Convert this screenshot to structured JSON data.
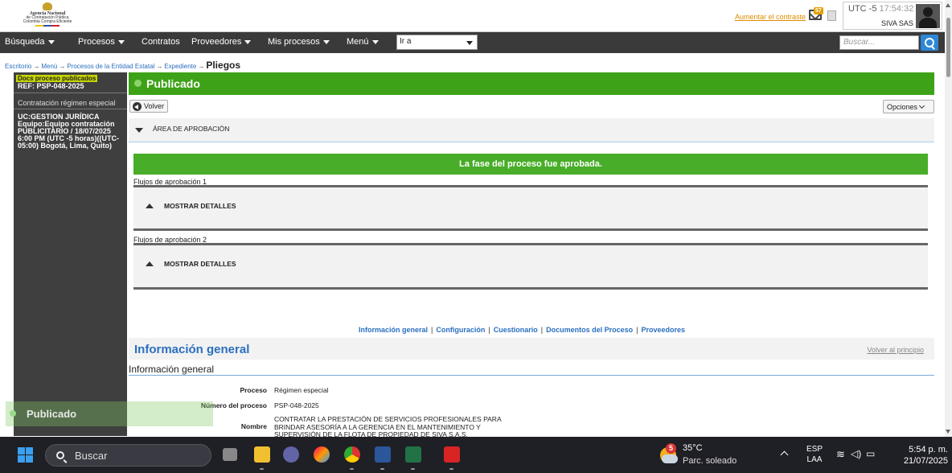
{
  "header": {
    "logo_line1": "Agencia Nacional",
    "logo_line2": "de Contratación Pública",
    "logo_line3": "Colombia Compra Eficiente",
    "contrast_link": "Aumentar el contraste",
    "mail_count": "57",
    "utc_label": "UTC -5",
    "utc_time": "17:54:32",
    "company": "SIVA SAS"
  },
  "nav": {
    "items": [
      "Búsqueda",
      "Procesos",
      "Contratos",
      "Proveedores",
      "Mis procesos",
      "Menú"
    ],
    "goto_value": "Ir a",
    "search_placeholder": "Buscar..."
  },
  "breadcrumb": {
    "items": [
      "Escritorio",
      "Menú",
      "Procesos de la Entidad Estatal",
      "Expediente"
    ],
    "current": "Pliegos"
  },
  "sidebar": {
    "selected_label": "Docs proceso publicados",
    "ref": "REF: PSP-048-2025",
    "item": "Contratación régimen especial",
    "info": "UC:GESTION JURÍDICA Equipo:Equipo contratación PUBLICITARIO / 18/07/2025 6:00 PM (UTC -5 horas)((UTC-05:00) Bogotá, Lima, Quito)"
  },
  "main": {
    "banner_title": "Publicado",
    "back_button": "Volver",
    "options_button": "Opciones",
    "approval_area": "ÁREA DE APROBACIÓN",
    "approved_message": "La fase del proceso fue aprobada.",
    "flows": [
      {
        "label": "Flujos de aprobación 1",
        "details": "MOSTRAR DETALLES"
      },
      {
        "label": "Flujos de aprobación 2",
        "details": "MOSTRAR DETALLES"
      }
    ],
    "section_links": [
      "Información general",
      "Configuración",
      "Cuestionario",
      "Documentos del Proceso",
      "Proveedores"
    ],
    "general_info_title": "Información general",
    "back_to_top": "Volver al principio",
    "general_info_subtitle": "Información general",
    "fields": {
      "proceso_label": "Proceso",
      "proceso_value": "Régimen especial",
      "numero_label": "Número del proceso",
      "numero_value": "PSP-048-2025",
      "nombre_label": "Nombre",
      "nombre_line1": "CONTRATAR LA PRESTACIÓN DE SERVICIOS PROFESIONALES PARA",
      "nombre_line2": "BRINDAR ASESORÍA A LA GERENCIA EN EL MANTENIMIENTO Y",
      "nombre_line3": "SUPERVISIÓN DE LA FLOTA DE PROPIEDAD DE SIVA S.A.S."
    },
    "overlay_label": "Publicado"
  },
  "taskbar": {
    "search": "Buscar",
    "weather_badge": "5",
    "temperature": "35°C",
    "weather": "Parc. soleado",
    "lang1": "ESP",
    "lang2": "LAA",
    "time": "5:54 p. m.",
    "date": "21/07/2025"
  },
  "colors": {
    "accent_green": "#3da217",
    "approved_green": "#48ad28",
    "nav_dark": "#3a3a3a",
    "link_blue": "#2a6fc0",
    "highlight_lime": "#c6d600"
  }
}
